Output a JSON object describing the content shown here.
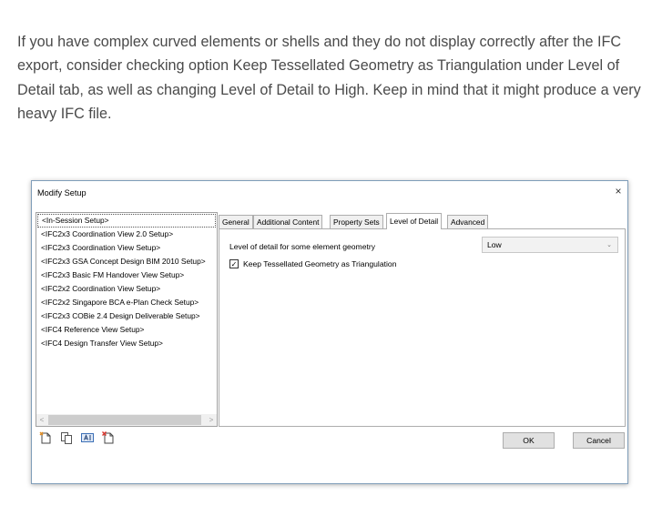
{
  "article": {
    "text": "If you have complex curved elements or shells and they do not display correctly after the IFC export, consider checking option Keep Tessellated Geometry as Triangulation under Level of Detail tab, as well as changing Level of Detail to High. Keep in mind that it might produce a very heavy IFC file."
  },
  "dialog": {
    "title": "Modify Setup",
    "close_glyph": "×",
    "setups": [
      "<In-Session Setup>",
      "<IFC2x3 Coordination View 2.0 Setup>",
      "<IFC2x3 Coordination View Setup>",
      "<IFC2x3 GSA Concept Design BIM 2010 Setup>",
      "<IFC2x3 Basic FM Handover View Setup>",
      "<IFC2x2 Coordination View Setup>",
      "<IFC2x2 Singapore BCA e-Plan Check Setup>",
      "<IFC2x3 COBie 2.4 Design Deliverable Setup>",
      "<IFC4 Reference View Setup>",
      "<IFC4 Design Transfer View Setup>"
    ],
    "scroll_left": "<",
    "scroll_right": ">",
    "tabs": [
      "General",
      "Additional Content",
      "Property Sets",
      "Level of Detail",
      "Advanced"
    ],
    "active_tab": "Level of Detail",
    "lod_label": "Level of detail for some element geometry",
    "lod_value": "Low",
    "lod_caret": "⌄",
    "keep_tessellated_label": "Keep Tessellated Geometry as Triangulation",
    "keep_tessellated_checked": true,
    "check_glyph": "✓",
    "icons": [
      "new-setup-icon",
      "duplicate-setup-icon",
      "rename-setup-icon",
      "delete-setup-icon"
    ],
    "ok_label": "OK",
    "cancel_label": "Cancel"
  },
  "colors": {
    "text": "#4a4a4a",
    "dialog_border": "#7f9db9",
    "icon_orange": "#e08a1e",
    "icon_blue": "#3b6fb6"
  }
}
